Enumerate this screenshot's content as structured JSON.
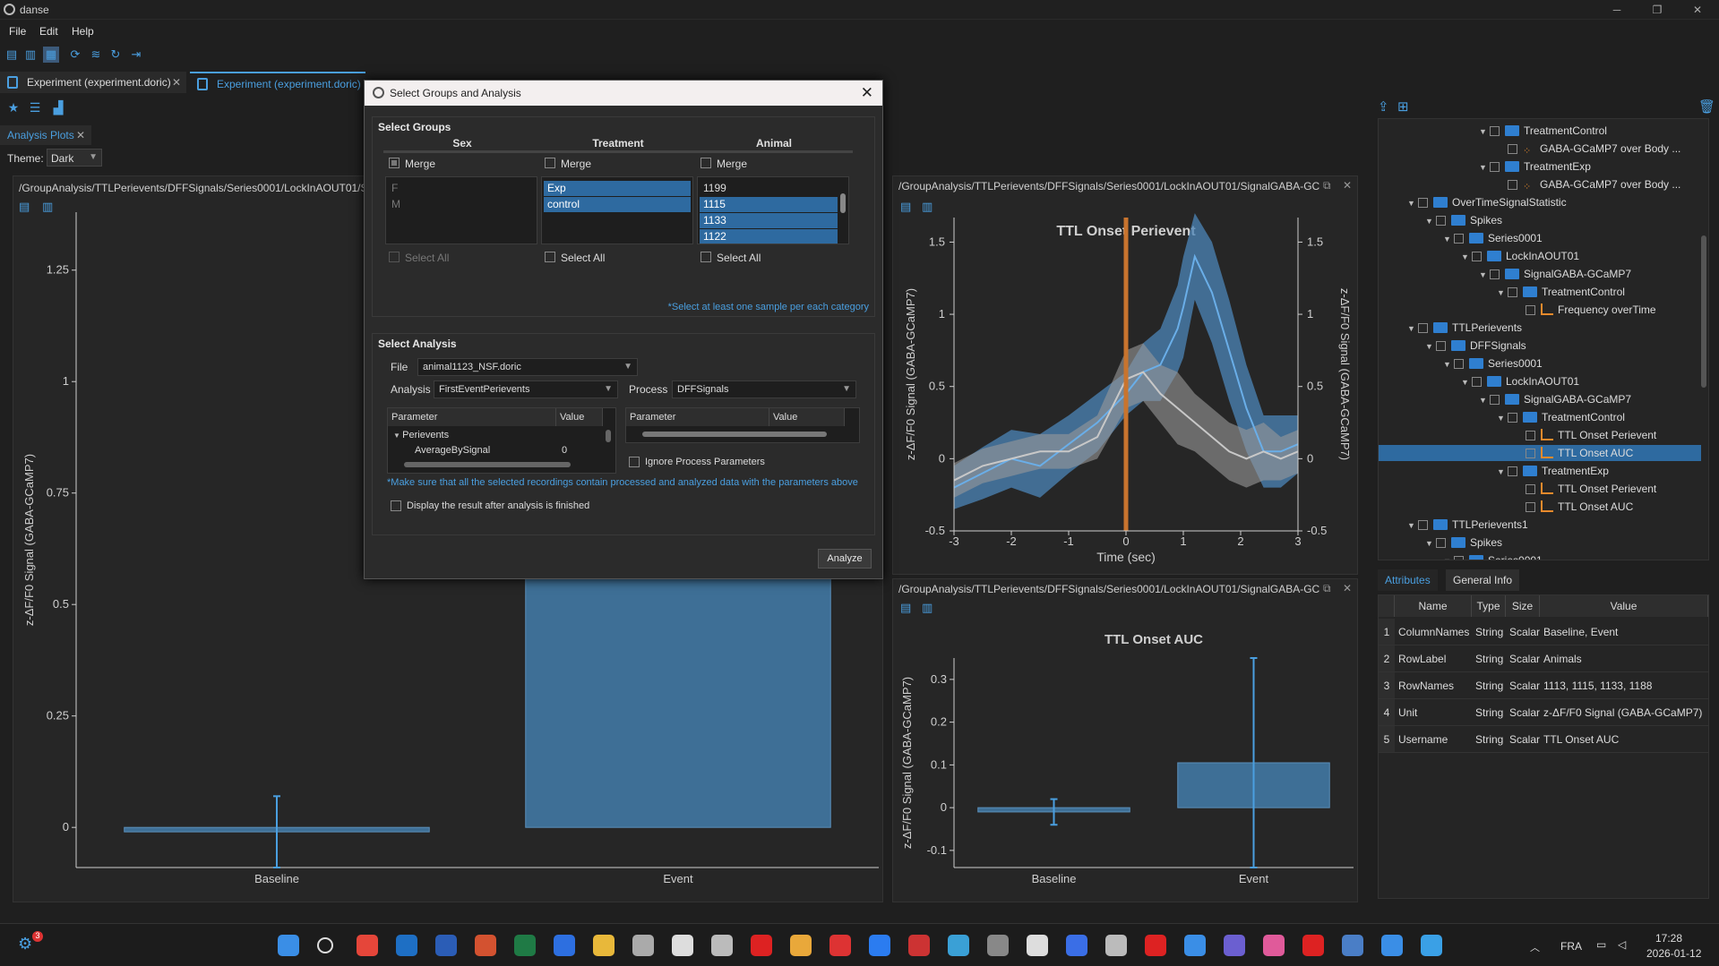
{
  "app": {
    "title": "danse"
  },
  "menu": [
    "File",
    "Edit",
    "Help"
  ],
  "doc_tabs": [
    {
      "label": "Experiment (experiment.doric)"
    },
    {
      "label": "Experiment (experiment.doric)"
    }
  ],
  "plots_tab": "Analysis Plots",
  "theme": {
    "label": "Theme:",
    "value": "Dark"
  },
  "left_plot": {
    "path": "/GroupAnalysis/TTLPerievents/DFFSignals/Series0001/LockInAOUT01/SignalGABA-GCaMP7",
    "chart_data": {
      "type": "bar",
      "categories": [
        "Baseline",
        "Event"
      ],
      "values": [
        -0.01,
        1.33
      ],
      "errors": [
        0.08,
        0.12
      ],
      "ylabel": "z-ΔF/F0 Signal (GABA-GCaMP7)",
      "ylim": [
        -0.09,
        1.38
      ],
      "yticks": [
        0,
        0.25,
        0.5,
        0.75,
        1,
        1.25
      ]
    }
  },
  "perievent_plot": {
    "path": "/GroupAnalysis/TTLPerievents/DFFSignals/Series0001/LockInAOUT01/SignalGABA-GC...",
    "chart_data": {
      "type": "line",
      "title": "TTL Onset Perievent",
      "xlabel": "Time (sec)",
      "ylabel": "z-ΔF/F0 Signal (GABA-GCaMP7)",
      "ylabel_right": "z-ΔF/F0 Signal (GABA-GCaMP7)",
      "xlim": [
        -3,
        3
      ],
      "ylim": [
        -0.5,
        1.67
      ],
      "xticks": [
        -3,
        -2,
        -1,
        0,
        1,
        2,
        3
      ],
      "yticks": [
        -0.5,
        0,
        0.5,
        1,
        1.5
      ],
      "onset": 0,
      "series": [
        {
          "color": "#4c86b8",
          "x": [
            -3,
            -2.5,
            -2,
            -1.5,
            -1,
            -0.5,
            0,
            0.3,
            0.6,
            0.9,
            1.0,
            1.2,
            1.5,
            1.8,
            2.1,
            2.4,
            2.7,
            3
          ],
          "y": [
            -0.2,
            -0.1,
            0.0,
            -0.05,
            0.1,
            0.25,
            0.45,
            0.6,
            0.65,
            0.9,
            1.05,
            1.4,
            1.15,
            0.75,
            0.35,
            0.05,
            0.05,
            0.1
          ],
          "spread": [
            0.15,
            0.18,
            0.2,
            0.22,
            0.2,
            0.2,
            0.15,
            0.2,
            0.25,
            0.3,
            0.35,
            0.3,
            0.35,
            0.35,
            0.3,
            0.25,
            0.25,
            0.2
          ]
        },
        {
          "color": "#9a9a9a",
          "x": [
            -3,
            -2.5,
            -2,
            -1.5,
            -1,
            -0.5,
            0,
            0.3,
            0.6,
            0.9,
            1.2,
            1.5,
            1.8,
            2.1,
            2.4,
            2.7,
            3
          ],
          "y": [
            -0.15,
            -0.05,
            0.0,
            0.05,
            0.05,
            0.15,
            0.55,
            0.6,
            0.45,
            0.35,
            0.25,
            0.15,
            0.05,
            0.0,
            0.05,
            0.0,
            0.05
          ],
          "spread": [
            0.12,
            0.12,
            0.12,
            0.12,
            0.12,
            0.15,
            0.2,
            0.2,
            0.2,
            0.25,
            0.2,
            0.2,
            0.2,
            0.2,
            0.2,
            0.15,
            0.15
          ]
        }
      ]
    }
  },
  "auc_plot": {
    "path": "/GroupAnalysis/TTLPerievents/DFFSignals/Series0001/LockInAOUT01/SignalGABA-GC...",
    "chart_data": {
      "type": "bar",
      "title": "TTL Onset AUC",
      "categories": [
        "Baseline",
        "Event"
      ],
      "values": [
        -0.01,
        0.105
      ],
      "errors": [
        0.03,
        0.245
      ],
      "ylabel": "z-ΔF/F0 Signal (GABA-GCaMP7)",
      "ylim": [
        -0.14,
        0.35
      ],
      "yticks": [
        -0.1,
        0,
        0.1,
        0.2,
        0.3
      ]
    }
  },
  "dialog": {
    "title": "Select Groups and Analysis",
    "groups_title": "Select Groups",
    "columns": [
      {
        "name": "Sex",
        "merge": "Merge",
        "merge_checked": true,
        "items": [
          {
            "label": "F",
            "sel": false,
            "dim": true
          },
          {
            "label": "M",
            "sel": false,
            "dim": true
          }
        ],
        "select_all": "Select All",
        "select_all_disabled": true
      },
      {
        "name": "Treatment",
        "merge": "Merge",
        "merge_checked": false,
        "items": [
          {
            "label": "Exp",
            "sel": true
          },
          {
            "label": "control",
            "sel": true
          }
        ],
        "select_all": "Select All",
        "select_all_disabled": false
      },
      {
        "name": "Animal",
        "merge": "Merge",
        "merge_checked": false,
        "items": [
          {
            "label": "1199",
            "sel": false
          },
          {
            "label": "1115",
            "sel": true
          },
          {
            "label": "1133",
            "sel": true
          },
          {
            "label": "1122",
            "sel": true
          }
        ],
        "select_all": "Select All",
        "select_all_disabled": false
      }
    ],
    "groups_note": "*Select at least one sample per each category",
    "analysis_title": "Select Analysis",
    "file_label": "File",
    "file_value": "animal1123_NSF.doric",
    "analysis_label": "Analysis",
    "analysis_value": "FirstEventPerievents",
    "process_label": "Process",
    "process_value": "DFFSignals",
    "param_headers": [
      "Parameter",
      "Value"
    ],
    "param_rows": [
      {
        "name": "Perievents",
        "value": ""
      },
      {
        "name": "AverageBySignal",
        "value": "0"
      }
    ],
    "ignore_label": "Ignore Process Parameters",
    "make_sure_note": "*Make sure that all the selected recordings contain processed and analyzed data with the parameters above",
    "display_label": "Display the result after analysis is finished",
    "analyze_button": "Analyze"
  },
  "tree": [
    {
      "label": "TreatmentControl",
      "level": 6,
      "type": "folder",
      "exp": true
    },
    {
      "label": "GABA-GCaMP7 over Body ...",
      "level": 7,
      "type": "scatter"
    },
    {
      "label": "TreatmentExp",
      "level": 6,
      "type": "folder",
      "exp": true
    },
    {
      "label": "GABA-GCaMP7 over Body ...",
      "level": 7,
      "type": "scatter"
    },
    {
      "label": "OverTimeSignalStatistic",
      "level": 2,
      "type": "folder",
      "exp": true
    },
    {
      "label": "Spikes",
      "level": 3,
      "type": "folder",
      "exp": true
    },
    {
      "label": "Series0001",
      "level": 4,
      "type": "folder",
      "exp": true
    },
    {
      "label": "LockInAOUT01",
      "level": 5,
      "type": "folder",
      "exp": true
    },
    {
      "label": "SignalGABA-GCaMP7",
      "level": 6,
      "type": "folder",
      "exp": true
    },
    {
      "label": "TreatmentControl",
      "level": 7,
      "type": "folder",
      "exp": true
    },
    {
      "label": "Frequency overTime",
      "level": 8,
      "type": "bar"
    },
    {
      "label": "TTLPerievents",
      "level": 2,
      "type": "folder",
      "exp": true
    },
    {
      "label": "DFFSignals",
      "level": 3,
      "type": "folder",
      "exp": true
    },
    {
      "label": "Series0001",
      "level": 4,
      "type": "folder",
      "exp": true
    },
    {
      "label": "LockInAOUT01",
      "level": 5,
      "type": "folder",
      "exp": true
    },
    {
      "label": "SignalGABA-GCaMP7",
      "level": 6,
      "type": "folder",
      "exp": true
    },
    {
      "label": "TreatmentControl",
      "level": 7,
      "type": "folder",
      "exp": true
    },
    {
      "label": "TTL Onset Perievent",
      "level": 8,
      "type": "line"
    },
    {
      "label": "TTL Onset AUC",
      "level": 8,
      "type": "bar",
      "selected": true
    },
    {
      "label": "TreatmentExp",
      "level": 7,
      "type": "folder",
      "exp": true
    },
    {
      "label": "TTL Onset Perievent",
      "level": 8,
      "type": "line"
    },
    {
      "label": "TTL Onset AUC",
      "level": 8,
      "type": "bar"
    },
    {
      "label": "TTLPerievents1",
      "level": 2,
      "type": "folder",
      "exp": true
    },
    {
      "label": "Spikes",
      "level": 3,
      "type": "folder",
      "exp": true
    },
    {
      "label": "Series0001",
      "level": 4,
      "type": "folder",
      "exp": true
    }
  ],
  "attr_tabs": [
    "Attributes",
    "General Info"
  ],
  "attr_headers": [
    "Name",
    "Type",
    "Size",
    "Value"
  ],
  "attr_rows": [
    {
      "n": "1",
      "name": "ColumnNames",
      "type": "String",
      "size": "Scalar",
      "value": "Baseline, Event"
    },
    {
      "n": "2",
      "name": "RowLabel",
      "type": "String",
      "size": "Scalar",
      "value": "Animals"
    },
    {
      "n": "3",
      "name": "RowNames",
      "type": "String",
      "size": "Scalar",
      "value": "1113, 1115, 1133, 1188"
    },
    {
      "n": "4",
      "name": "Unit",
      "type": "String",
      "size": "Scalar",
      "value": "z-ΔF/F0 Signal (GABA-GCaMP7)"
    },
    {
      "n": "5",
      "name": "Username",
      "type": "String",
      "size": "Scalar",
      "value": "TTL Onset AUC"
    }
  ],
  "taskbar": {
    "lang": "FRA",
    "time": "17:28",
    "date": "2026-01-12",
    "badge": "3"
  },
  "colors": {
    "accent": "#4a9fe0",
    "bar": "#3e6f96",
    "onset": "#c8742e",
    "selected": "#2e6aa0"
  }
}
